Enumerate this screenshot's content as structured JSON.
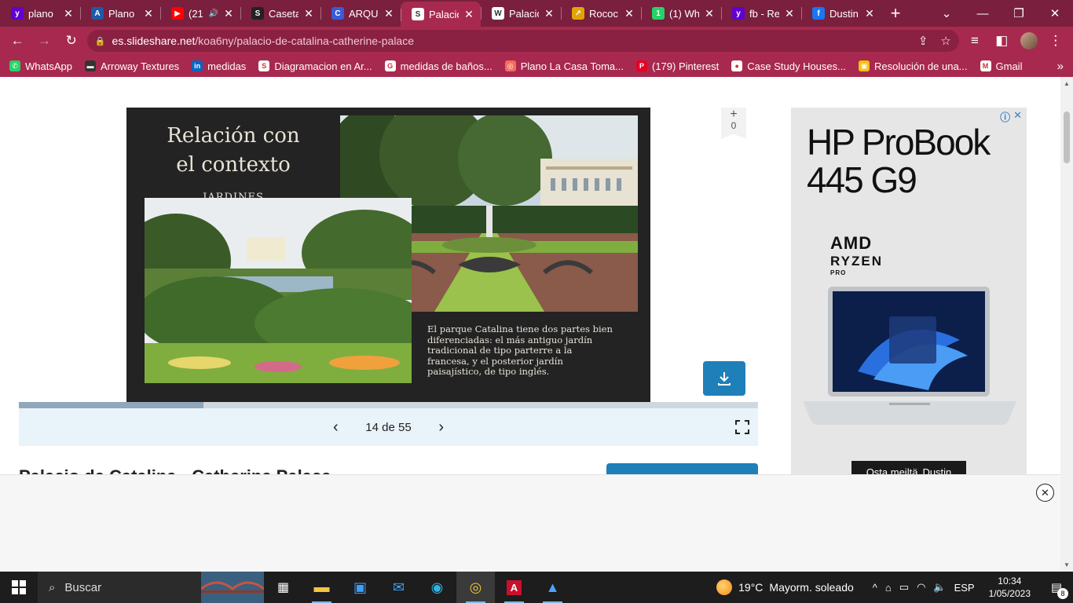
{
  "browser": {
    "tabs": [
      {
        "label": "plano",
        "favicon": "yahoo-icon",
        "color": "#6001d2",
        "glyph": "y",
        "active": false,
        "muted": false
      },
      {
        "label": "Plano",
        "favicon": "archdaily-icon",
        "color": "#1e5aa8",
        "glyph": "A",
        "active": false,
        "muted": false
      },
      {
        "label": "(21",
        "favicon": "youtube-icon",
        "color": "#ff0000",
        "glyph": "▶",
        "active": false,
        "muted": true
      },
      {
        "label": "Caseta",
        "favicon": "document-icon",
        "color": "#222222",
        "glyph": "S",
        "active": false,
        "muted": false
      },
      {
        "label": "ARQUI",
        "favicon": "c-circle-icon",
        "color": "#3a5bd9",
        "glyph": "C",
        "active": false,
        "muted": false
      },
      {
        "label": "Palacio",
        "favicon": "slideshare-icon",
        "color": "#ffffff",
        "glyph": "S",
        "active": true,
        "muted": false
      },
      {
        "label": "Palacio",
        "favicon": "wikipedia-icon",
        "color": "#ffffff",
        "glyph": "W",
        "active": false,
        "muted": false
      },
      {
        "label": "Rococ",
        "favicon": "folder-link-icon",
        "color": "#e3a400",
        "glyph": "↗",
        "active": false,
        "muted": false
      },
      {
        "label": "(1) Wh",
        "favicon": "whatsapp-icon",
        "color": "#25d366",
        "glyph": "1",
        "active": false,
        "muted": false
      },
      {
        "label": "fb - Re",
        "favicon": "yahoo-icon",
        "color": "#6001d2",
        "glyph": "y",
        "active": false,
        "muted": false
      },
      {
        "label": "Dustin",
        "favicon": "facebook-icon",
        "color": "#1877f2",
        "glyph": "f",
        "active": false,
        "muted": false
      }
    ],
    "url_host": "es.slideshare.net",
    "url_path": "/koa6ny/palacio-de-catalina-catherine-palace",
    "bookmarks": [
      {
        "label": "WhatsApp",
        "icon": "whatsapp-icon",
        "color": "#25d366",
        "glyph": "✆"
      },
      {
        "label": "Arroway Textures",
        "icon": "arroway-icon",
        "color": "#333333",
        "glyph": "▬"
      },
      {
        "label": "medidas",
        "icon": "linkedin-icon",
        "color": "#0a66c2",
        "glyph": "in"
      },
      {
        "label": "Diagramacion en Ar...",
        "icon": "slideshare-icon",
        "color": "#ffffff",
        "glyph": "S"
      },
      {
        "label": "medidas de baños...",
        "icon": "google-icon",
        "color": "#ffffff",
        "glyph": "G"
      },
      {
        "label": "Plano La Casa Toma...",
        "icon": "issuu-icon",
        "color": "#f36d5d",
        "glyph": "◎"
      },
      {
        "label": "(179) Pinterest",
        "icon": "pinterest-icon",
        "color": "#e60023",
        "glyph": "P"
      },
      {
        "label": "Case Study Houses...",
        "icon": "globe-icon",
        "color": "#ffffff",
        "glyph": "●"
      },
      {
        "label": "Resolución de una...",
        "icon": "book-icon",
        "color": "#f4c20d",
        "glyph": "▣"
      },
      {
        "label": "Gmail",
        "icon": "gmail-icon",
        "color": "#ffffff",
        "glyph": "M"
      }
    ]
  },
  "slide": {
    "title_main": "Relación con el contexto",
    "title_tag": "JARDINES",
    "caption": "El parque Catalina tiene dos partes bien diferenciadas: el más antiguo jardín tradicional de tipo parterre a la francesa, y el posterior jardín paisajístico, de tipo inglés."
  },
  "viewer": {
    "likes": "0",
    "counter": "14 de 55",
    "progress": 0.25,
    "doc_title": "Palacio de Catalina - Catherine Palace"
  },
  "ad": {
    "headline": "HP ProBook 445 G9",
    "brand_line1": "AMD",
    "brand_line2": "RYZEN",
    "brand_line3": "PRO",
    "cta": "Osta meiltä",
    "cta_brand": "Dustin"
  },
  "taskbar": {
    "search_placeholder": "Buscar",
    "weather_temp": "19°C",
    "weather_text": "Mayorm. soleado",
    "language": "ESP",
    "time": "10:34",
    "date": "1/05/2023",
    "notification_count": "8"
  },
  "colors": {
    "tab_strip": "#7a1f3d",
    "toolbar": "#a8294f",
    "slideshare_blue": "#1f7fb8",
    "slide_bg": "#232323"
  }
}
